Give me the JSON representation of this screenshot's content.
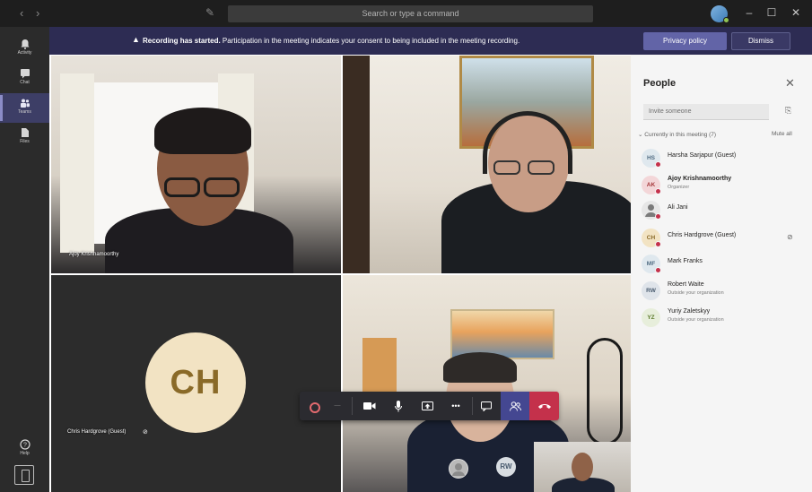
{
  "titlebar": {
    "search_placeholder": "Search or type a command",
    "back": "‹",
    "forward": "›",
    "compose": "✎",
    "minimize": "–",
    "maximize": "☐",
    "close": "✕"
  },
  "rail": {
    "items": [
      {
        "label": "Activity"
      },
      {
        "label": "Chat"
      },
      {
        "label": "Teams"
      },
      {
        "label": "Files"
      },
      {
        "label": "Help"
      }
    ]
  },
  "banner": {
    "warning_icon": "▲",
    "bold_text": "Recording has started.",
    "text": " Participation in the meeting indicates your consent to being included in the meeting recording.",
    "privacy_label": "Privacy policy",
    "dismiss_label": "Dismiss"
  },
  "tiles": {
    "tile1_name": "Ajoy Krishnamoorthy",
    "tile3_avatar": "CH",
    "tile3_name": "Chris Hardgrove (Guest)",
    "mini_avatar1": "",
    "mini_avatar2": "RW"
  },
  "controls": {
    "timer": "—",
    "video": "▣",
    "mic": "🎤",
    "share": "⬆",
    "more": "•••",
    "chat": "▢",
    "people": "☺",
    "hangup": "☎"
  },
  "people_panel": {
    "title": "People",
    "close": "✕",
    "invite_placeholder": "Invite someone",
    "share_icon": "⎘",
    "section_label": "⌄  Currently in this meeting (7)",
    "mute_all": "Mute all",
    "people": [
      {
        "initials": "HS",
        "name": "Harsha Sarjapur (Guest)",
        "sub": "",
        "bold": false,
        "avatar_bg": "#dfe8ee",
        "avatar_fg": "#4f6b82",
        "badge": true,
        "mic": false
      },
      {
        "initials": "AK",
        "name": "Ajoy Krishnamoorthy",
        "sub": "Organizer",
        "bold": true,
        "avatar_bg": "#f3d6d8",
        "avatar_fg": "#a4373a",
        "badge": true,
        "mic": false
      },
      {
        "initials": "",
        "name": "Ali Jani",
        "sub": "",
        "bold": false,
        "avatar_bg": "#e6e6e6",
        "avatar_fg": "#616161",
        "badge": true,
        "mic": false
      },
      {
        "initials": "CH",
        "name": "Chris Hardgrove (Guest)",
        "sub": "",
        "bold": false,
        "avatar_bg": "#f2e3c3",
        "avatar_fg": "#8a6a28",
        "badge": true,
        "mic": true
      },
      {
        "initials": "MF",
        "name": "Mark Franks",
        "sub": "",
        "bold": false,
        "avatar_bg": "#dfe8ee",
        "avatar_fg": "#4f6b82",
        "badge": true,
        "mic": false
      },
      {
        "initials": "RW",
        "name": "Robert Waite",
        "sub": "Outside your organization",
        "bold": false,
        "avatar_bg": "#dfe4ea",
        "avatar_fg": "#4a5c70",
        "badge": false,
        "mic": false
      },
      {
        "initials": "YZ",
        "name": "Yuriy Zaletskyy",
        "sub": "Outside your organization",
        "bold": false,
        "avatar_bg": "#e7eedb",
        "avatar_fg": "#5b7a2a",
        "badge": false,
        "mic": false
      }
    ]
  },
  "colors": {
    "banner_bg": "#2d2c53",
    "accent": "#6264a7",
    "hangup": "#c4314b",
    "presence": "#92c353"
  }
}
